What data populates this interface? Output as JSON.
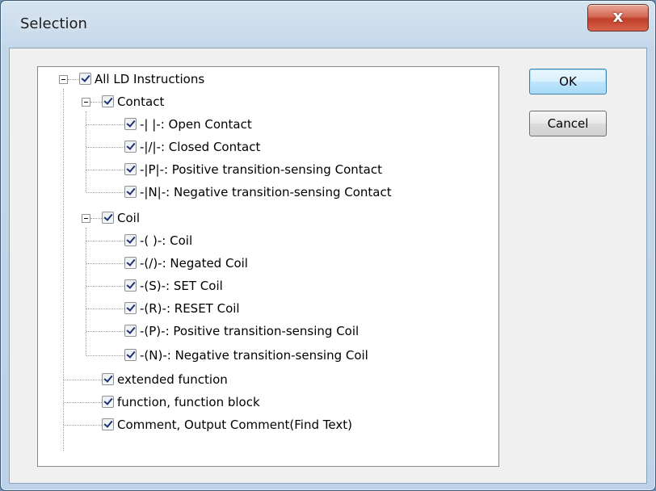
{
  "window": {
    "title": "Selection",
    "close_label": "x"
  },
  "buttons": {
    "ok": "OK",
    "cancel": "Cancel"
  },
  "tree": {
    "root": {
      "label": "All LD Instructions",
      "checked": true
    },
    "contact": {
      "label": "Contact",
      "checked": true,
      "items": [
        {
          "label": "-| |-: Open Contact",
          "checked": true
        },
        {
          "label": "-|/|-: Closed Contact",
          "checked": true
        },
        {
          "label": "-|P|-: Positive transition-sensing Contact",
          "checked": true
        },
        {
          "label": "-|N|-: Negative transition-sensing Contact",
          "checked": true
        }
      ]
    },
    "coil": {
      "label": "Coil",
      "checked": true,
      "items": [
        {
          "label": "-( )-: Coil",
          "checked": true
        },
        {
          "label": "-(/)-: Negated Coil",
          "checked": true
        },
        {
          "label": "-(S)-: SET Coil",
          "checked": true
        },
        {
          "label": "-(R)-: RESET Coil",
          "checked": true
        },
        {
          "label": "-(P)-: Positive transition-sensing Coil",
          "checked": true
        },
        {
          "label": "-(N)-: Negative transition-sensing Coil",
          "checked": true
        }
      ]
    },
    "others": [
      {
        "label": "extended function",
        "checked": true
      },
      {
        "label": "function, function block",
        "checked": true
      },
      {
        "label": "Comment, Output Comment(Find Text)",
        "checked": true
      }
    ]
  }
}
